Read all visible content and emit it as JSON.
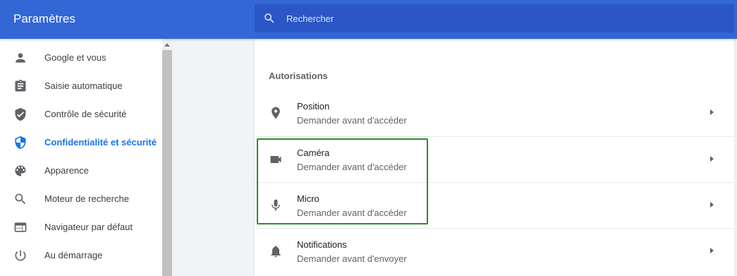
{
  "header": {
    "title": "Paramètres",
    "search_placeholder": "Rechercher"
  },
  "sidebar": {
    "items": [
      {
        "label": "Google et vous",
        "icon": "person-icon"
      },
      {
        "label": "Saisie automatique",
        "icon": "clipboard-icon"
      },
      {
        "label": "Contrôle de sécurité",
        "icon": "shield-check-icon"
      },
      {
        "label": "Confidentialité et sécurité",
        "icon": "shield-icon",
        "active": true
      },
      {
        "label": "Apparence",
        "icon": "palette-icon"
      },
      {
        "label": "Moteur de recherche",
        "icon": "search-icon"
      },
      {
        "label": "Navigateur par défaut",
        "icon": "browser-icon"
      },
      {
        "label": "Au démarrage",
        "icon": "power-icon"
      }
    ]
  },
  "main": {
    "section_title": "Autorisations",
    "permissions": [
      {
        "title": "Position",
        "subtitle": "Demander avant d'accéder",
        "icon": "location-icon"
      },
      {
        "title": "Caméra",
        "subtitle": "Demander avant d'accéder",
        "icon": "camera-icon"
      },
      {
        "title": "Micro",
        "subtitle": "Demander avant d'accéder",
        "icon": "microphone-icon"
      },
      {
        "title": "Notifications",
        "subtitle": "Demander avant d'envoyer",
        "icon": "bell-icon"
      }
    ]
  },
  "colors": {
    "header_bg": "#3367d6",
    "search_bg": "#2a56c6",
    "active_nav": "#1a73e8",
    "highlight_border": "#2e8b2e"
  }
}
